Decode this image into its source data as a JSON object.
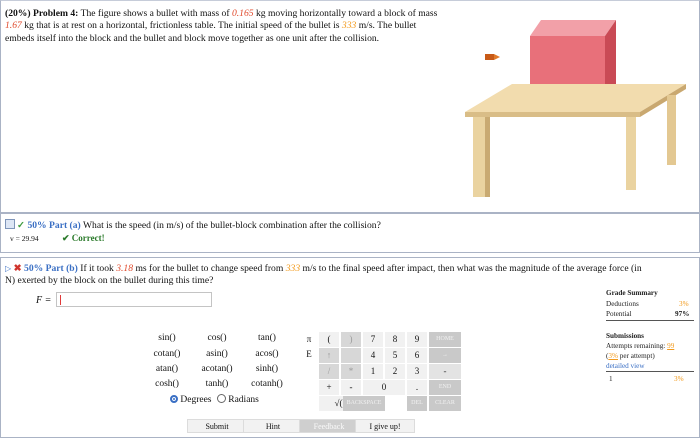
{
  "problem": {
    "header": "(20%) Problem 4:",
    "text1": "The figure shows a bullet with mass of",
    "bullet_mass": "0.165",
    "text2": "kg moving horizontally toward a block of mass",
    "block_mass": "1.67",
    "text3": "kg that is at rest on a horizontal, frictionless table. The initial speed of the bullet is",
    "speed": "333",
    "text4": "m/s. The bullet embeds itself into the block and the bullet and block move together as one unit after the collision."
  },
  "part_a": {
    "percent": "50% Part (a)",
    "question": "What is the speed (in m/s) of the bullet-block combination after the collision?",
    "answer": "v = 29.94",
    "status": "✔ Correct!"
  },
  "part_b": {
    "percent": "50% Part (b)",
    "q1": "If it took",
    "time": "3.18",
    "q2": "ms for the bullet to change speed from",
    "speed": "333",
    "q3": "m/s to the final speed after impact, then what was the magnitude of the average force (in",
    "q4": "N) exerted by the block on the bullet during this time?",
    "input_label": "F ="
  },
  "calculator": {
    "functions": [
      [
        "sin()",
        "cos()",
        "tan()"
      ],
      [
        "cotan()",
        "asin()",
        "acos()"
      ],
      [
        "atan()",
        "acotan()",
        "sinh()"
      ],
      [
        "cosh()",
        "tanh()",
        "cotanh()"
      ]
    ],
    "symbols": [
      "π",
      "E"
    ],
    "keys": {
      "open_paren": "(",
      "close_paren": ")",
      "seven": "7",
      "eight": "8",
      "nine": "9",
      "home": "HOME",
      "up": "↑",
      "four": "4",
      "five": "5",
      "six": "6",
      "right": "→",
      "slash": "/",
      "star": "*",
      "one": "1",
      "two": "2",
      "three": "3",
      "minus": "-",
      "plus": "+",
      "dash": "-",
      "zero": "0",
      "dot": ".",
      "end": "END",
      "sqrt": "√()",
      "backspace": "BACKSPACE",
      "del": "DEL",
      "clear": "CLEAR"
    },
    "degrees": "Degrees",
    "radians": "Radians"
  },
  "buttons": {
    "submit": "Submit",
    "hint": "Hint",
    "feedback": "Feedback",
    "give_up": "I give up!"
  },
  "grade_summary": {
    "title": "Grade Summary",
    "deductions_label": "Deductions",
    "deductions_value": "3%",
    "potential_label": "Potential",
    "potential_value": "97%"
  },
  "submissions": {
    "title": "Submissions",
    "attempts_label": "Attempts remaining:",
    "attempts_value": "99",
    "per_attempt_prefix": "(",
    "per_attempt_pct": "3%",
    "per_attempt_suffix": " per attempt)",
    "detailed_view": "detailed view",
    "row_number": "1",
    "row_value": "3%"
  },
  "colors": {
    "accent_blue": "#3a6fc4",
    "given_red": "#e0492b",
    "given_orange": "#f29a1c",
    "correct_green": "#2a7a2a"
  }
}
